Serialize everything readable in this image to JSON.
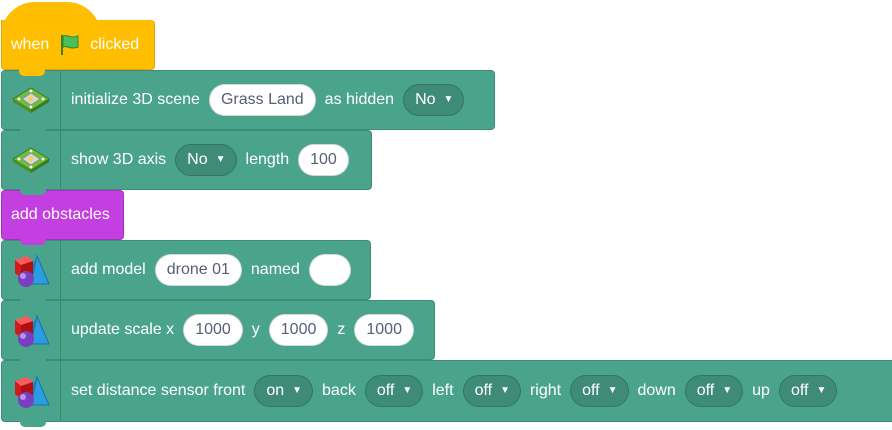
{
  "colors": {
    "event": "#ffbf00",
    "extension": "#4aa48c",
    "dropdown": "#3e8c77",
    "custom": "#c43fe0",
    "field_text": "#575e75"
  },
  "hat_block": {
    "pre": "when",
    "flag_icon": "green-flag-icon",
    "post": "clicked"
  },
  "init_scene": {
    "label": "initialize 3D scene",
    "scene": "Grass Land",
    "hidden_label": "as hidden",
    "hidden": "No",
    "icon": "3d-scene-icon"
  },
  "show_axis": {
    "label": "show 3D axis",
    "axis": "No",
    "length_label": "length",
    "length": "100",
    "icon": "3d-scene-icon"
  },
  "add_obstacles": {
    "label": "add obstacles"
  },
  "add_model": {
    "label": "add model",
    "model": "drone 01",
    "named_label": "named",
    "name": "",
    "icon": "3d-shapes-icon"
  },
  "update_scale": {
    "label": "update scale x",
    "x": "1000",
    "y_label": "y",
    "y": "1000",
    "z_label": "z",
    "z": "1000",
    "icon": "3d-shapes-icon"
  },
  "distance_sensor": {
    "label": "set distance sensor front",
    "front": "on",
    "back_label": "back",
    "back": "off",
    "left_label": "left",
    "left": "off",
    "right_label": "right",
    "right": "off",
    "down_label": "down",
    "down": "off",
    "up_label": "up",
    "up": "off",
    "icon": "3d-shapes-icon"
  }
}
